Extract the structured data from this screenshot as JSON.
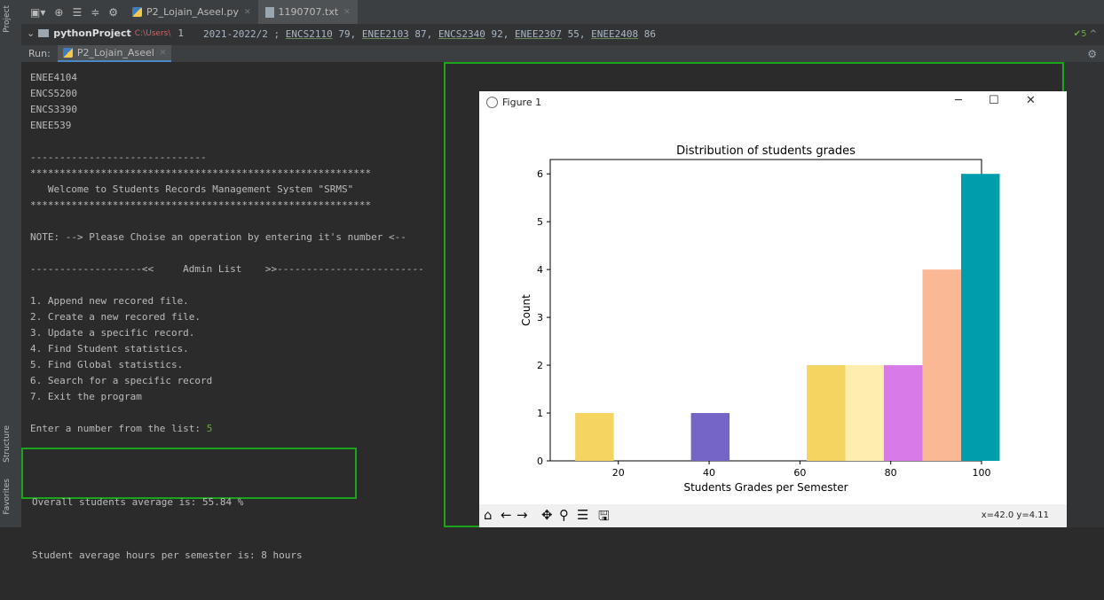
{
  "left_strip": {
    "project_label": "Project",
    "structure_label": "Structure",
    "favorites_label": "Favorites"
  },
  "editor_tabs": [
    {
      "label": "P2_Lojain_Aseel.py"
    },
    {
      "label": "1190707.txt"
    }
  ],
  "project_bar": {
    "name": "pythonProject",
    "path": "C:\\Users\\",
    "line_number": "1",
    "file_text_prefix": "2021-2022/2 ; ",
    "courses": [
      {
        "code": "ENCS2110",
        "grade": " 79, "
      },
      {
        "code": "ENEE2103",
        "grade": " 87, "
      },
      {
        "code": "ENCS2340",
        "grade": " 92, "
      },
      {
        "code": "ENEE2307",
        "grade": " 55, "
      },
      {
        "code": "ENEE2408",
        "grade": " 86"
      }
    ],
    "right_indicator": "5"
  },
  "run_bar": {
    "label": "Run:",
    "tab": "P2_Lojain_Aseel"
  },
  "console": {
    "lines": [
      "ENEE4104",
      "ENCS5200",
      "ENCS3390",
      "ENEE539",
      "",
      "------------------------------",
      "**********************************************************",
      "   Welcome to Students Records Management System \"SRMS\"",
      "**********************************************************",
      "",
      "NOTE: --> Please Choise an operation by entering it's number <--",
      "",
      "-------------------<<     Admin List    >>-------------------------",
      "",
      "1. Append new recored file.",
      "2. Create a new recored file.",
      "3. Update a specific record.",
      "4. Find Student statistics.",
      "5. Find Global statistics.",
      "6. Search for a specific record",
      "7. Exit the program",
      ""
    ],
    "prompt": "Enter a number from the list: ",
    "prompt_input": "5",
    "stats": [
      "Overall students average is: 55.84 %",
      "Student average hours per semester is: 8 hours"
    ]
  },
  "figure": {
    "window_title": "Figure 1",
    "coords": "x=42.0 y=4.11",
    "toolbar": [
      "home-icon",
      "back-icon",
      "forward-icon",
      "pan-icon",
      "zoom-icon",
      "configure-icon",
      "save-icon"
    ]
  },
  "chart_data": {
    "type": "bar",
    "title": "Distribution of students grades",
    "xlabel": "Students Grades per Semester",
    "ylabel": "Count",
    "xlim": [
      5,
      100
    ],
    "ylim": [
      0,
      6.3
    ],
    "xticks": [
      20,
      40,
      60,
      80,
      100
    ],
    "yticks": [
      0,
      1,
      2,
      3,
      4,
      5,
      6
    ],
    "bin_width": 8.5,
    "bars": [
      {
        "x": 10.5,
        "value": 1,
        "color": "#f5d462"
      },
      {
        "x": 36.0,
        "value": 1,
        "color": "#7465c6"
      },
      {
        "x": 61.5,
        "value": 2,
        "color": "#f5d462"
      },
      {
        "x": 70.0,
        "value": 2,
        "color": "#fdeeaf"
      },
      {
        "x": 78.5,
        "value": 2,
        "color": "#d87ae8"
      },
      {
        "x": 87.0,
        "value": 4,
        "color": "#fbb895"
      },
      {
        "x": 95.5,
        "value": 6,
        "color": "#009ead"
      }
    ]
  }
}
